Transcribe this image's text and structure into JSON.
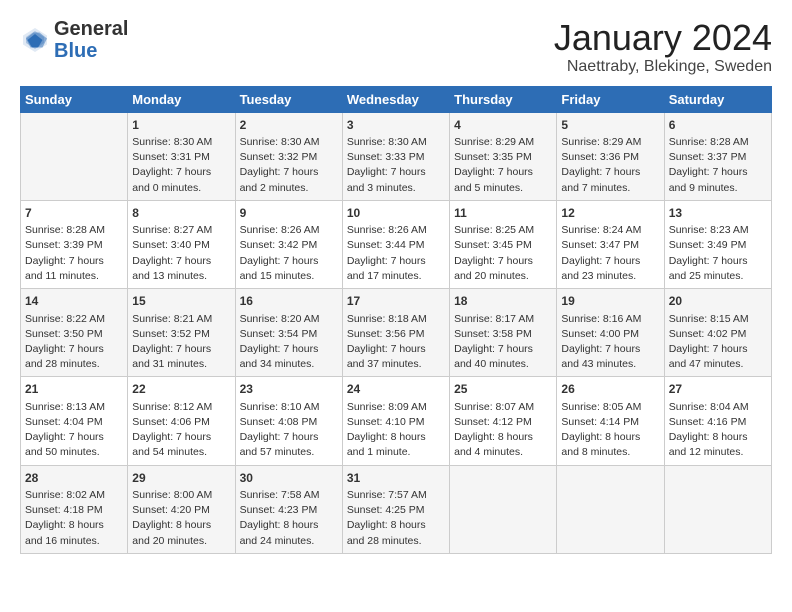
{
  "header": {
    "logo_general": "General",
    "logo_blue": "Blue",
    "month_title": "January 2024",
    "subtitle": "Naettraby, Blekinge, Sweden"
  },
  "days_of_week": [
    "Sunday",
    "Monday",
    "Tuesday",
    "Wednesday",
    "Thursday",
    "Friday",
    "Saturday"
  ],
  "weeks": [
    [
      {
        "day": "",
        "info": ""
      },
      {
        "day": "1",
        "info": "Sunrise: 8:30 AM\nSunset: 3:31 PM\nDaylight: 7 hours\nand 0 minutes."
      },
      {
        "day": "2",
        "info": "Sunrise: 8:30 AM\nSunset: 3:32 PM\nDaylight: 7 hours\nand 2 minutes."
      },
      {
        "day": "3",
        "info": "Sunrise: 8:30 AM\nSunset: 3:33 PM\nDaylight: 7 hours\nand 3 minutes."
      },
      {
        "day": "4",
        "info": "Sunrise: 8:29 AM\nSunset: 3:35 PM\nDaylight: 7 hours\nand 5 minutes."
      },
      {
        "day": "5",
        "info": "Sunrise: 8:29 AM\nSunset: 3:36 PM\nDaylight: 7 hours\nand 7 minutes."
      },
      {
        "day": "6",
        "info": "Sunrise: 8:28 AM\nSunset: 3:37 PM\nDaylight: 7 hours\nand 9 minutes."
      }
    ],
    [
      {
        "day": "7",
        "info": ""
      },
      {
        "day": "8",
        "info": "Sunrise: 8:27 AM\nSunset: 3:40 PM\nDaylight: 7 hours\nand 13 minutes."
      },
      {
        "day": "9",
        "info": "Sunrise: 8:26 AM\nSunset: 3:42 PM\nDaylight: 7 hours\nand 15 minutes."
      },
      {
        "day": "10",
        "info": "Sunrise: 8:26 AM\nSunset: 3:44 PM\nDaylight: 7 hours\nand 17 minutes."
      },
      {
        "day": "11",
        "info": "Sunrise: 8:25 AM\nSunset: 3:45 PM\nDaylight: 7 hours\nand 20 minutes."
      },
      {
        "day": "12",
        "info": "Sunrise: 8:24 AM\nSunset: 3:47 PM\nDaylight: 7 hours\nand 23 minutes."
      },
      {
        "day": "13",
        "info": "Sunrise: 8:23 AM\nSunset: 3:49 PM\nDaylight: 7 hours\nand 25 minutes."
      }
    ],
    [
      {
        "day": "14",
        "info": ""
      },
      {
        "day": "15",
        "info": "Sunrise: 8:21 AM\nSunset: 3:52 PM\nDaylight: 7 hours\nand 31 minutes."
      },
      {
        "day": "16",
        "info": "Sunrise: 8:20 AM\nSunset: 3:54 PM\nDaylight: 7 hours\nand 34 minutes."
      },
      {
        "day": "17",
        "info": "Sunrise: 8:18 AM\nSunset: 3:56 PM\nDaylight: 7 hours\nand 37 minutes."
      },
      {
        "day": "18",
        "info": "Sunrise: 8:17 AM\nSunset: 3:58 PM\nDaylight: 7 hours\nand 40 minutes."
      },
      {
        "day": "19",
        "info": "Sunrise: 8:16 AM\nSunset: 4:00 PM\nDaylight: 7 hours\nand 43 minutes."
      },
      {
        "day": "20",
        "info": "Sunrise: 8:15 AM\nSunset: 4:02 PM\nDaylight: 7 hours\nand 47 minutes."
      }
    ],
    [
      {
        "day": "21",
        "info": ""
      },
      {
        "day": "22",
        "info": "Sunrise: 8:12 AM\nSunset: 4:06 PM\nDaylight: 7 hours\nand 54 minutes."
      },
      {
        "day": "23",
        "info": "Sunrise: 8:10 AM\nSunset: 4:08 PM\nDaylight: 7 hours\nand 57 minutes."
      },
      {
        "day": "24",
        "info": "Sunrise: 8:09 AM\nSunset: 4:10 PM\nDaylight: 8 hours\nand 1 minute."
      },
      {
        "day": "25",
        "info": "Sunrise: 8:07 AM\nSunset: 4:12 PM\nDaylight: 8 hours\nand 4 minutes."
      },
      {
        "day": "26",
        "info": "Sunrise: 8:05 AM\nSunset: 4:14 PM\nDaylight: 8 hours\nand 8 minutes."
      },
      {
        "day": "27",
        "info": "Sunrise: 8:04 AM\nSunset: 4:16 PM\nDaylight: 8 hours\nand 12 minutes."
      }
    ],
    [
      {
        "day": "28",
        "info": ""
      },
      {
        "day": "29",
        "info": "Sunrise: 8:00 AM\nSunset: 4:20 PM\nDaylight: 8 hours\nand 20 minutes."
      },
      {
        "day": "30",
        "info": "Sunrise: 7:58 AM\nSunset: 4:23 PM\nDaylight: 8 hours\nand 24 minutes."
      },
      {
        "day": "31",
        "info": "Sunrise: 7:57 AM\nSunset: 4:25 PM\nDaylight: 8 hours\nand 28 minutes."
      },
      {
        "day": "",
        "info": ""
      },
      {
        "day": "",
        "info": ""
      },
      {
        "day": "",
        "info": ""
      }
    ]
  ],
  "week1_sun": "Sunrise: 8:28 AM\nSunset: 3:39 PM\nDaylight: 7 hours\nand 11 minutes.",
  "week3_sun": "Sunrise: 8:22 AM\nSunset: 3:50 PM\nDaylight: 7 hours\nand 28 minutes.",
  "week4_sun": "Sunrise: 8:13 AM\nSunset: 4:04 PM\nDaylight: 7 hours\nand 50 minutes.",
  "week5_sun": "Sunrise: 8:02 AM\nSunset: 4:18 PM\nDaylight: 8 hours\nand 16 minutes."
}
